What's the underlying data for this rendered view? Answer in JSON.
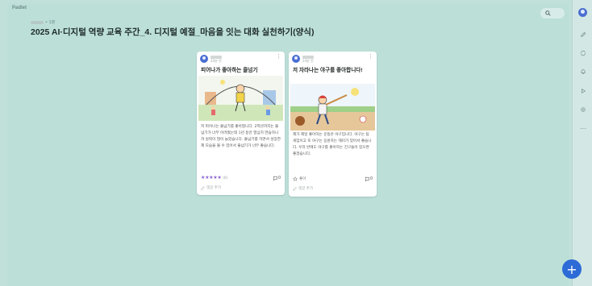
{
  "app": {
    "brand": "Padlet"
  },
  "board": {
    "meta_suffix": "• 1분",
    "title": "2025 AI·디지털 역량 교육 주간_4. 디지털 예절_마음을 잇는 대화 실천하기(양식)"
  },
  "cards": [
    {
      "time": "24분 전",
      "title": "피어나가 좋아하는 줄넘기",
      "body": "저 피어나는 줄넘기를 좋아합니다. 2학년까지는 줄넘기가 너무 어려웠는데 1년 동안 열심히 연습하니까 실력이 많이 늘었습니다. 줄넘기를 하면서 성장한 제 모습을 볼 수 있어서 줄넘기가 너무 좋습니다.",
      "rating_count": "(0)",
      "comment_count": "0",
      "add_comment": "댓글 추가"
    },
    {
      "time": "24분 전",
      "title": "저 자라나는 야구를 좋아합니다!",
      "body": "제가 제일 좋아하는 운동은 야구입니다. 야구는 팀 게임이고 또 야구는 응원하는 재미가 있어서 좋습니다. 우리 반에도 야구를 좋아하는 친구들이 있으면 좋겠습니다.",
      "like_label": "좋아",
      "comment_count": "0",
      "add_comment": "댓글 추가"
    }
  ],
  "colors": {
    "accent": "#2d6bd6",
    "board_bg": "#bcdfd8",
    "star": "#8a63d2"
  }
}
